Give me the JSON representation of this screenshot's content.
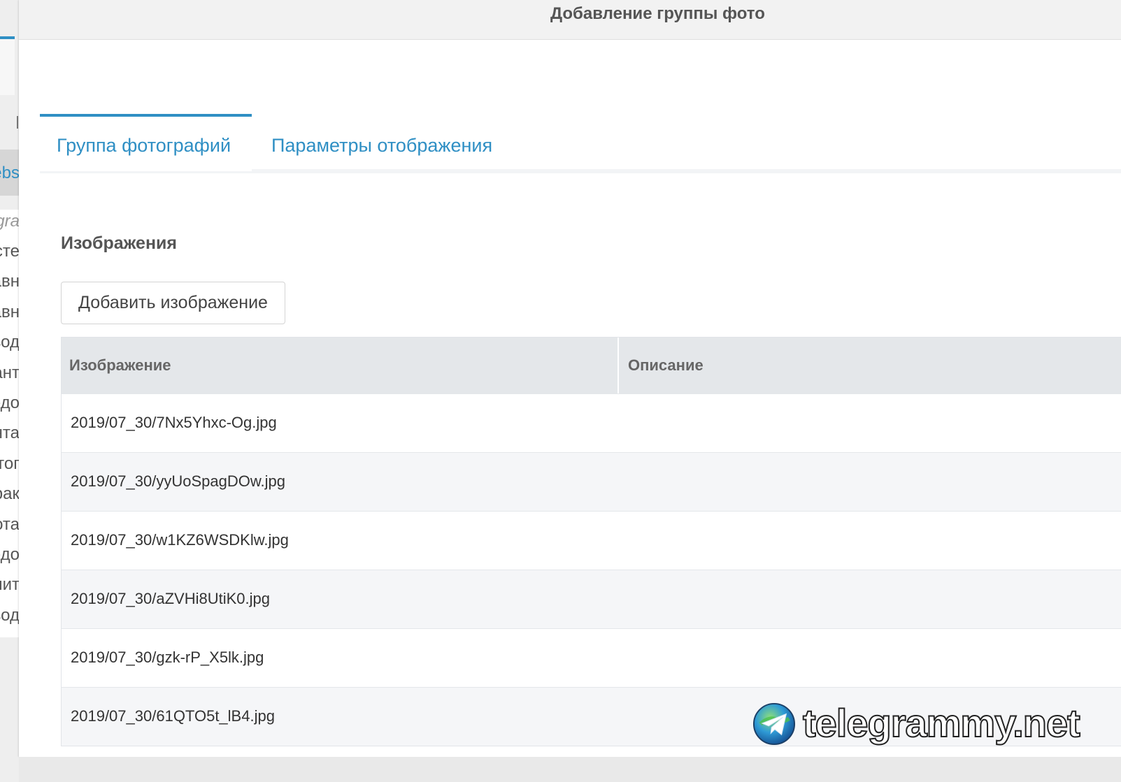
{
  "sidebar": {
    "fragments": [
      "ebs",
      "gra",
      "сте",
      "авн",
      "авн",
      "вод",
      "ант",
      "едо",
      "нта",
      "тог",
      "рак",
      "ота",
      "едо",
      "лит",
      "вод"
    ]
  },
  "modal": {
    "title": "Добавление группы фото",
    "tabs": [
      {
        "label": "Группа фотографий",
        "active": true
      },
      {
        "label": "Параметры отображения",
        "active": false
      }
    ],
    "section_title": "Изображения",
    "add_button": "Добавить изображение",
    "table": {
      "columns": [
        "Изображение",
        "Описание"
      ],
      "rows": [
        {
          "image": "2019/07_30/7Nx5Yhxc-Og.jpg",
          "description": ""
        },
        {
          "image": "2019/07_30/yyUoSpagDOw.jpg",
          "description": ""
        },
        {
          "image": "2019/07_30/w1KZ6WSDKlw.jpg",
          "description": ""
        },
        {
          "image": "2019/07_30/aZVHi8UtiK0.jpg",
          "description": ""
        },
        {
          "image": "2019/07_30/gzk-rP_X5lk.jpg",
          "description": ""
        },
        {
          "image": "2019/07_30/61QTO5t_lB4.jpg",
          "description": ""
        }
      ]
    }
  },
  "watermark": {
    "text": "telegrammy.net",
    "logo": "telegram-globe-icon"
  },
  "colors": {
    "accent": "#2f8fc4",
    "header_bg": "#f2f2f2",
    "table_header_bg": "#e4e7ea",
    "row_alt_bg": "#f5f6f8"
  }
}
